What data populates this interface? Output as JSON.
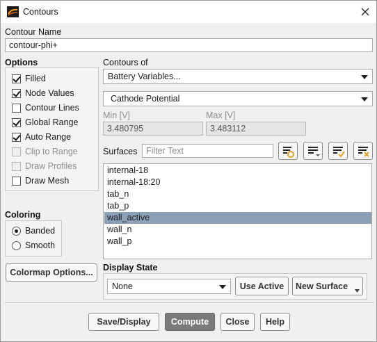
{
  "window": {
    "title": "Contours",
    "app_icon": "fluent-icon",
    "close_icon": "close-icon"
  },
  "contour_name": {
    "label": "Contour Name",
    "value": "contour-phi+"
  },
  "options": {
    "title": "Options",
    "items": [
      {
        "label": "Filled",
        "checked": true,
        "enabled": true
      },
      {
        "label": "Node Values",
        "checked": true,
        "enabled": true
      },
      {
        "label": "Contour Lines",
        "checked": false,
        "enabled": true
      },
      {
        "label": "Global Range",
        "checked": true,
        "enabled": true
      },
      {
        "label": "Auto Range",
        "checked": true,
        "enabled": true
      },
      {
        "label": "Clip to Range",
        "checked": false,
        "enabled": false
      },
      {
        "label": "Draw Profiles",
        "checked": false,
        "enabled": false
      },
      {
        "label": "Draw Mesh",
        "checked": false,
        "enabled": true
      }
    ]
  },
  "contours_of": {
    "label": "Contours of",
    "category": "Battery Variables...",
    "variable": "Cathode Potential",
    "min_label": "Min [V]",
    "min_value": "3.480795",
    "max_label": "Max [V]",
    "max_value": "3.483112"
  },
  "surfaces": {
    "label": "Surfaces",
    "filter_placeholder": "Filter Text",
    "icons": [
      "surface-new-icon",
      "surface-list-menu-icon",
      "select-all-icon",
      "deselect-all-icon"
    ],
    "items": [
      {
        "label": "internal-18",
        "selected": false
      },
      {
        "label": "internal-18:20",
        "selected": false
      },
      {
        "label": "tab_n",
        "selected": false
      },
      {
        "label": "tab_p",
        "selected": false
      },
      {
        "label": "wall_active",
        "selected": true
      },
      {
        "label": "wall_n",
        "selected": false
      },
      {
        "label": "wall_p",
        "selected": false
      }
    ]
  },
  "coloring": {
    "title": "Coloring",
    "options": [
      {
        "label": "Banded",
        "selected": true
      },
      {
        "label": "Smooth",
        "selected": false
      }
    ]
  },
  "colormap_button": "Colormap Options...",
  "display_state": {
    "label": "Display State",
    "value": "None",
    "use_active": "Use Active",
    "new_surface": "New Surface"
  },
  "footer": {
    "save_display": "Save/Display",
    "compute": "Compute",
    "close": "Close",
    "help": "Help"
  },
  "colors": {
    "selection": "#8ca1b8",
    "compute_button": "#7a7a7a",
    "icon_accent": "#e8a020"
  }
}
